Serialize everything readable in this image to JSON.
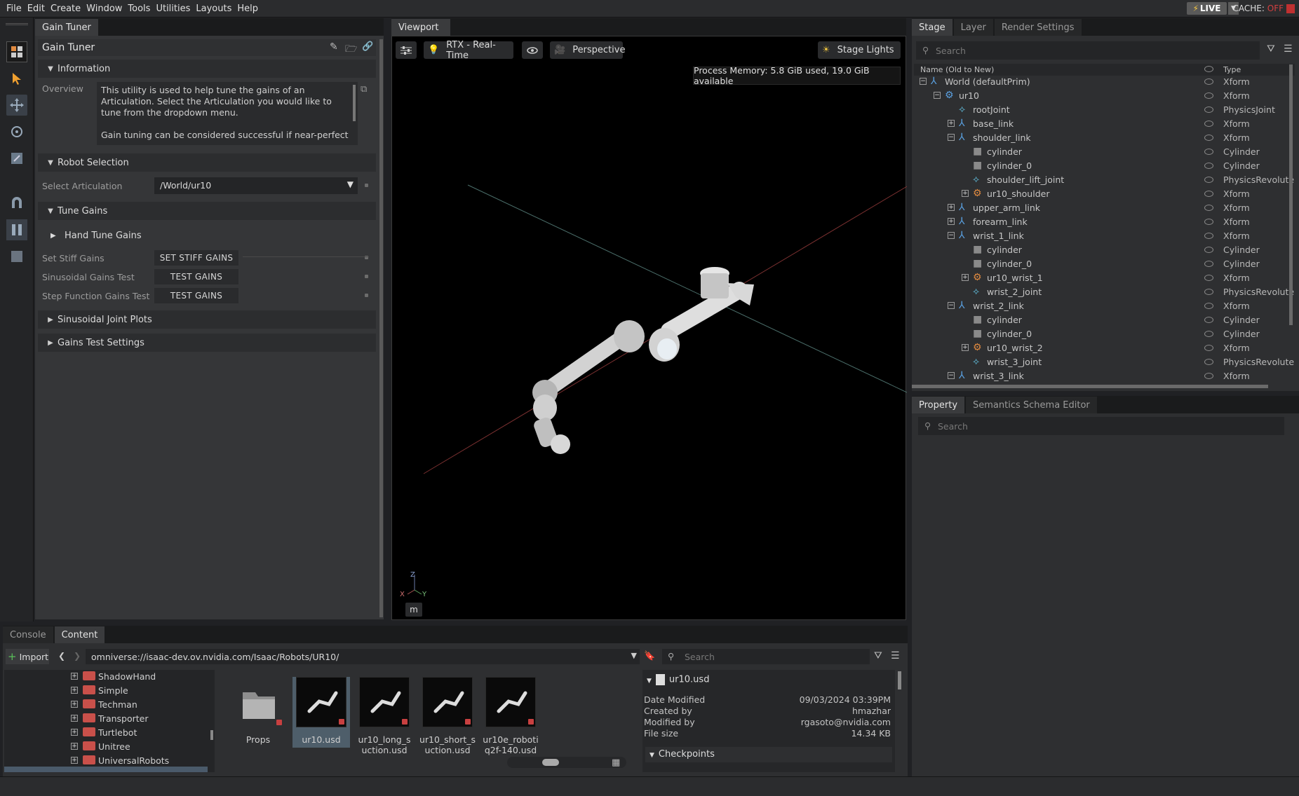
{
  "menu": [
    "File",
    "Edit",
    "Create",
    "Window",
    "Tools",
    "Utilities",
    "Layouts",
    "Help"
  ],
  "live": {
    "label": "LIVE",
    "bolt": "⚡"
  },
  "cache": {
    "label": "CACHE:",
    "state": "OFF"
  },
  "left_panel": {
    "tab": "Gain Tuner",
    "title": "Gain Tuner",
    "information": {
      "header": "Information",
      "overview_label": "Overview",
      "text1": "This utility is used to help tune the gains of an Articulation. Select the Articulation you would like to tune from the dropdown menu.",
      "text2": "Gain tuning can be considered successful if near-perfect"
    },
    "robot_selection": {
      "header": "Robot Selection",
      "label": "Select Articulation",
      "value": "/World/ur10"
    },
    "tune_gains": {
      "header": "Tune Gains",
      "hand_tune": "Hand Tune Gains",
      "rows": [
        {
          "label": "Set Stiff Gains",
          "button": "SET STIFF GAINS"
        },
        {
          "label": "Sinusoidal Gains Test",
          "button": "TEST GAINS"
        },
        {
          "label": "Step Function Gains Test",
          "button": "TEST GAINS"
        }
      ]
    },
    "sinusoidal_plots": "Sinusoidal Joint Plots",
    "gains_test_settings": "Gains Test Settings"
  },
  "viewport": {
    "tab": "Viewport",
    "render_mode": "RTX - Real-Time",
    "camera": "Perspective",
    "lights": "Stage Lights",
    "memory": "Process Memory: 5.8 GiB used, 19.0 GiB available",
    "units": "m",
    "axes": {
      "z": "Z",
      "x": "X",
      "y": "Y"
    }
  },
  "stage": {
    "tabs": [
      "Stage",
      "Layer",
      "Render Settings"
    ],
    "search_placeholder": "Search",
    "col_name": "Name (Old to New)",
    "col_type": "Type",
    "rows": [
      {
        "name": "World (defaultPrim)",
        "type": "Xform",
        "indent": 0,
        "exp": "−",
        "icon": "x"
      },
      {
        "name": "ur10",
        "type": "Xform",
        "indent": 1,
        "exp": "−",
        "icon": "robot"
      },
      {
        "name": "rootJoint",
        "type": "PhysicsJoint",
        "indent": 2,
        "exp": "",
        "icon": "j"
      },
      {
        "name": "base_link",
        "type": "Xform",
        "indent": 2,
        "exp": "+",
        "icon": "x"
      },
      {
        "name": "shoulder_link",
        "type": "Xform",
        "indent": 2,
        "exp": "−",
        "icon": "x"
      },
      {
        "name": "cylinder",
        "type": "Cylinder",
        "indent": 3,
        "exp": "",
        "icon": "cyl"
      },
      {
        "name": "cylinder_0",
        "type": "Cylinder",
        "indent": 3,
        "exp": "",
        "icon": "cyl"
      },
      {
        "name": "shoulder_lift_joint",
        "type": "PhysicsRevolute",
        "indent": 3,
        "exp": "",
        "icon": "j"
      },
      {
        "name": "ur10_shoulder",
        "type": "Xform",
        "indent": 3,
        "exp": "+",
        "icon": "r"
      },
      {
        "name": "upper_arm_link",
        "type": "Xform",
        "indent": 2,
        "exp": "+",
        "icon": "x"
      },
      {
        "name": "forearm_link",
        "type": "Xform",
        "indent": 2,
        "exp": "+",
        "icon": "x"
      },
      {
        "name": "wrist_1_link",
        "type": "Xform",
        "indent": 2,
        "exp": "−",
        "icon": "x"
      },
      {
        "name": "cylinder",
        "type": "Cylinder",
        "indent": 3,
        "exp": "",
        "icon": "cyl"
      },
      {
        "name": "cylinder_0",
        "type": "Cylinder",
        "indent": 3,
        "exp": "",
        "icon": "cyl"
      },
      {
        "name": "ur10_wrist_1",
        "type": "Xform",
        "indent": 3,
        "exp": "+",
        "icon": "r"
      },
      {
        "name": "wrist_2_joint",
        "type": "PhysicsRevolute",
        "indent": 3,
        "exp": "",
        "icon": "j"
      },
      {
        "name": "wrist_2_link",
        "type": "Xform",
        "indent": 2,
        "exp": "−",
        "icon": "x"
      },
      {
        "name": "cylinder",
        "type": "Cylinder",
        "indent": 3,
        "exp": "",
        "icon": "cyl"
      },
      {
        "name": "cylinder_0",
        "type": "Cylinder",
        "indent": 3,
        "exp": "",
        "icon": "cyl"
      },
      {
        "name": "ur10_wrist_2",
        "type": "Xform",
        "indent": 3,
        "exp": "+",
        "icon": "r"
      },
      {
        "name": "wrist_3_joint",
        "type": "PhysicsRevolute",
        "indent": 3,
        "exp": "",
        "icon": "j"
      },
      {
        "name": "wrist_3_link",
        "type": "Xform",
        "indent": 2,
        "exp": "−",
        "icon": "x"
      }
    ]
  },
  "property": {
    "tabs": [
      "Property",
      "Semantics Schema Editor"
    ],
    "search_placeholder": "Search"
  },
  "bottom": {
    "tabs": [
      "Console",
      "Content"
    ],
    "import": "Import",
    "path": "omniverse://isaac-dev.ov.nvidia.com/Isaac/Robots/UR10/",
    "search_placeholder": "Search",
    "folders": [
      "ShadowHand",
      "Simple",
      "Techman",
      "Transporter",
      "Turtlebot",
      "Unitree",
      "UniversalRobots"
    ],
    "items": [
      {
        "l1": "Props",
        "l2": ""
      },
      {
        "l1": "ur10.usd",
        "l2": ""
      },
      {
        "l1": "ur10_long_s",
        "l2": "uction.usd"
      },
      {
        "l1": "ur10_short_s",
        "l2": "uction.usd"
      },
      {
        "l1": "ur10e_roboti",
        "l2": "q2f-140.usd"
      }
    ],
    "details": {
      "file": "ur10.usd",
      "rows": [
        {
          "k": "Date Modified",
          "v": "09/03/2024 03:39PM"
        },
        {
          "k": "Created by",
          "v": "hmazhar"
        },
        {
          "k": "Modified by",
          "v": "rgasoto@nvidia.com"
        },
        {
          "k": "File size",
          "v": "14.34 KB"
        }
      ],
      "checkpoints": "Checkpoints"
    }
  }
}
